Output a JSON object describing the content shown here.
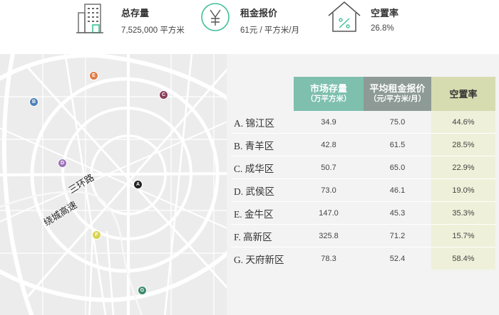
{
  "kpis": [
    {
      "icon": "building-icon",
      "label": "总存量",
      "value": "7,525,000 平方米"
    },
    {
      "icon": "yen-icon",
      "label": "租金报价",
      "value": "61元 / 平方米/月"
    },
    {
      "icon": "house-percent-icon",
      "label": "空置率",
      "value": "26.8%"
    }
  ],
  "map": {
    "labels": {
      "ring": "三环路",
      "expressway": "绕城高速"
    },
    "markers": [
      {
        "letter": "A",
        "color": "#222222"
      },
      {
        "letter": "B",
        "color": "#4e7fb8"
      },
      {
        "letter": "C",
        "color": "#8b3c5a"
      },
      {
        "letter": "D",
        "color": "#9b72b8"
      },
      {
        "letter": "E",
        "color": "#e07b45"
      },
      {
        "letter": "F",
        "color": "#d8d44c"
      },
      {
        "letter": "G",
        "color": "#3c8c6c"
      }
    ]
  },
  "table": {
    "headers": {
      "stock": "市场存量",
      "stock_unit": "（万平方米）",
      "rent": "平均租金报价",
      "rent_unit": "（元/平方米/月）",
      "vacancy": "空置率"
    },
    "rows": [
      {
        "district": "A. 锦江区",
        "stock": "34.9",
        "rent": "75.0",
        "vacancy": "44.6%"
      },
      {
        "district": "B. 青羊区",
        "stock": "42.8",
        "rent": "61.5",
        "vacancy": "28.5%"
      },
      {
        "district": "C. 成华区",
        "stock": "50.7",
        "rent": "65.0",
        "vacancy": "22.9%"
      },
      {
        "district": "D. 武侯区",
        "stock": "73.0",
        "rent": "46.1",
        "vacancy": "19.0%"
      },
      {
        "district": "E. 金牛区",
        "stock": "147.0",
        "rent": "45.3",
        "vacancy": "35.3%"
      },
      {
        "district": "F. 高新区",
        "stock": "325.8",
        "rent": "71.2",
        "vacancy": "15.7%"
      },
      {
        "district": "G. 天府新区",
        "stock": "78.3",
        "rent": "52.4",
        "vacancy": "58.4%"
      }
    ]
  },
  "colors": {
    "stock_header": "#7ebfae",
    "rent_header": "#8d9a96",
    "vacancy_header": "#d7dbb0",
    "vacancy_cell": "#eef0d9",
    "accent_green": "#3fbf9a"
  }
}
